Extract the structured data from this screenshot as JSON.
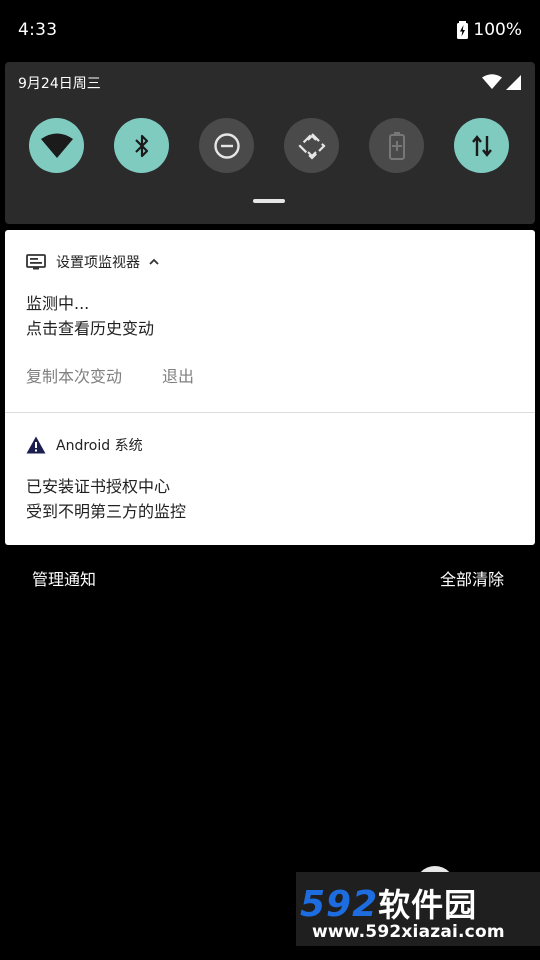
{
  "status_bar": {
    "time": "4:33",
    "battery": "100%"
  },
  "quick_settings": {
    "date": "9月24日周三",
    "tiles": [
      {
        "name": "wifi-tile",
        "icon": "wifi-icon",
        "state": "on"
      },
      {
        "name": "bluetooth-tile",
        "icon": "bluetooth-icon",
        "state": "on"
      },
      {
        "name": "dnd-tile",
        "icon": "do-not-disturb-icon",
        "state": "off"
      },
      {
        "name": "auto-rotate-tile",
        "icon": "auto-rotate-icon",
        "state": "off"
      },
      {
        "name": "battery-saver-tile",
        "icon": "battery-saver-icon",
        "state": "disabled"
      },
      {
        "name": "mobile-data-tile",
        "icon": "data-transfer-icon",
        "state": "on"
      }
    ],
    "colors": {
      "tile_on": "#7fcbc0",
      "tile_off": "#4a4a4a"
    }
  },
  "notifications": [
    {
      "app": "设置项监视器",
      "line1": "监测中...",
      "line2": "点击查看历史变动",
      "actions": [
        "复制本次变动",
        "退出"
      ]
    },
    {
      "app": "Android 系统",
      "line1": "已安装证书授权中心",
      "line2": "受到不明第三方的监控"
    }
  ],
  "footer": {
    "manage": "管理通知",
    "clear_all": "全部清除"
  },
  "watermark": {
    "logo_num": "592",
    "logo_cn": "软件园",
    "url": "www.592xiazai.com"
  }
}
